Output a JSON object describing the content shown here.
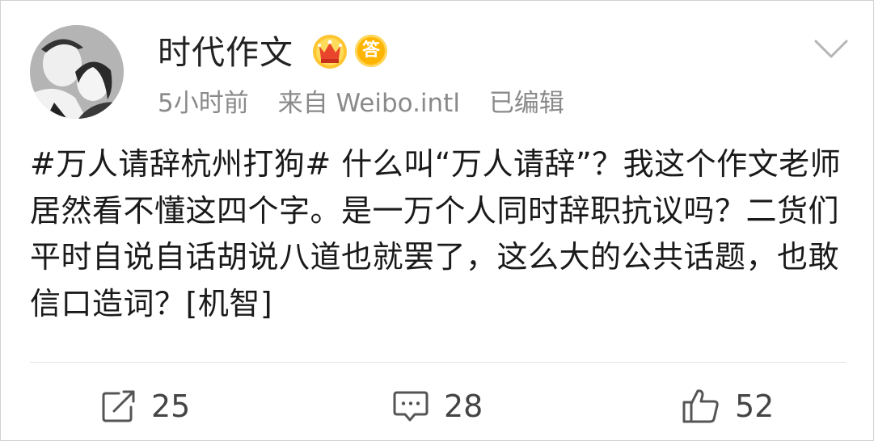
{
  "post": {
    "username": "时代作文",
    "answer_badge_text": "答",
    "time": "5小时前",
    "source": "来自 Weibo.intl",
    "edited": "已编辑",
    "content": "#万人请辞杭州打狗# 什么叫“万人请辞”？我这个作文老师居然看不懂这四个字。是一万个人同时辞职抗议吗？二货们平时自说自话胡说八道也就罢了，这么大的公共话题，也敢信口造词？[机智]"
  },
  "actions": {
    "repost_count": "25",
    "comment_count": "28",
    "like_count": "52"
  },
  "icons": {
    "avatar": "avatar-photo",
    "crown": "crown-badge-icon",
    "answer": "answer-badge-icon",
    "menu": "chevron-down-icon",
    "repost": "repost-icon",
    "comment": "comment-icon",
    "like": "thumbs-up-icon"
  },
  "colors": {
    "badge_gold": "#ffb400",
    "crown_red": "#e8452c",
    "meta_gray": "#8a8a8a"
  }
}
